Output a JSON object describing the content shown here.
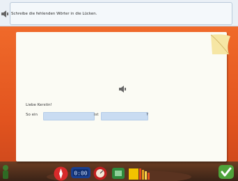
{
  "instruction": "Schreibe die fehlenden Wörter in die Lücken.",
  "letter": {
    "greeting": "Liebe Kerstin!",
    "sentence_start": "So ein",
    "sentence_middle": "ist",
    "sentence_end": "?",
    "blanks": [
      "",
      ""
    ]
  },
  "toolbar": {
    "timer": "0:00"
  },
  "colors": {
    "background": "#e2541f",
    "paper": "#fbfbf4",
    "blank": "#c9dcf2",
    "confirm": "#4ea33a"
  },
  "icons": [
    "speaker-icon",
    "character-figure",
    "compass-icon",
    "timer-display",
    "gauge-icon",
    "notebook-icon",
    "book-icon",
    "checkmark-icon"
  ]
}
